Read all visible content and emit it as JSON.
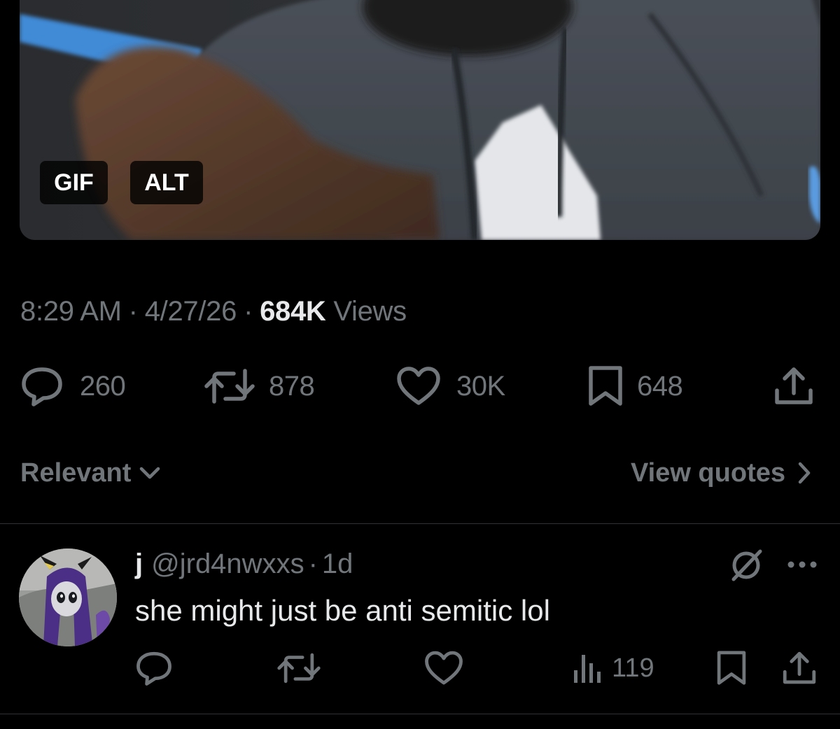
{
  "media": {
    "badges": {
      "gif": "GIF",
      "alt": "ALT"
    }
  },
  "post_meta": {
    "time": "8:29 AM",
    "separator": "·",
    "date": "4/27/26",
    "views_count": "684K",
    "views_label": "Views"
  },
  "actions": {
    "replies": "260",
    "reposts": "878",
    "likes": "30K",
    "bookmarks": "648"
  },
  "sort": {
    "label": "Relevant",
    "view_quotes": "View quotes"
  },
  "reply": {
    "name": "j",
    "handle": "@jrd4nwxxs",
    "separator": "·",
    "age": "1d",
    "text": "she might just be anti semitic lol",
    "views": "119"
  },
  "colors": {
    "background": "#000000",
    "primary_text": "#e7e9ea",
    "secondary_text": "#71767b",
    "divider": "#2f3336"
  },
  "icons": {
    "reply": "comment-bubble-icon",
    "repost": "repost-arrows-icon",
    "like": "heart-icon",
    "bookmark": "bookmark-icon",
    "share": "share-upload-icon",
    "views": "bar-chart-icon",
    "grok": "grok-slash-circle-icon",
    "more": "more-dots-icon",
    "chevron_down": "chevron-down-icon",
    "chevron_right": "chevron-right-icon"
  }
}
